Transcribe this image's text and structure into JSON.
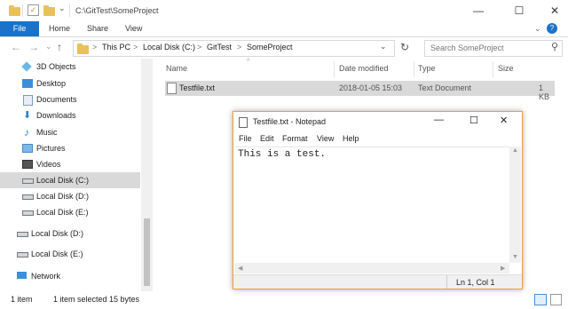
{
  "titlebar": {
    "path_title": "C:\\GitTest\\SomeProject",
    "minimize": "—",
    "maximize": "☐",
    "close": "✕"
  },
  "ribbon": {
    "tabs": [
      "File",
      "Home",
      "Share",
      "View"
    ],
    "expand": "⌄",
    "help": "?"
  },
  "address": {
    "back": "←",
    "forward": "→",
    "history": "⌄",
    "up": "↑",
    "crumbs": [
      "This PC",
      "Local Disk (C:)",
      "GitTest",
      "SomeProject"
    ],
    "sep": ">",
    "dropdown": "⌄",
    "refresh": "↻",
    "search_placeholder": "Search SomeProject"
  },
  "nav": {
    "items": [
      {
        "label": "3D Objects",
        "icon": "cube-icon"
      },
      {
        "label": "Desktop",
        "icon": "desktop-icon"
      },
      {
        "label": "Documents",
        "icon": "documents-icon"
      },
      {
        "label": "Downloads",
        "icon": "downloads-icon"
      },
      {
        "label": "Music",
        "icon": "music-icon"
      },
      {
        "label": "Pictures",
        "icon": "pictures-icon"
      },
      {
        "label": "Videos",
        "icon": "videos-icon"
      },
      {
        "label": "Local Disk (C:)",
        "icon": "drive-icon",
        "selected": true
      },
      {
        "label": "Local Disk (D:)",
        "icon": "drive-icon"
      },
      {
        "label": "Local Disk (E:)",
        "icon": "drive-icon"
      },
      {
        "label": "Local Disk (D:)",
        "icon": "drive-icon"
      },
      {
        "label": "Local Disk (E:)",
        "icon": "drive-icon"
      },
      {
        "label": "Network",
        "icon": "network-icon"
      }
    ]
  },
  "filelist": {
    "columns": [
      "Name",
      "Date modified",
      "Type",
      "Size"
    ],
    "rows": [
      {
        "name": "Testfile.txt",
        "date": "2018-01-05 15:03",
        "type": "Text Document",
        "size": "1 KB"
      }
    ]
  },
  "status": {
    "count": "1 item",
    "selected": "1 item selected  15 bytes"
  },
  "notepad": {
    "title": "Testfile.txt - Notepad",
    "menu": [
      "File",
      "Edit",
      "Format",
      "View",
      "Help"
    ],
    "content": "This is a test.",
    "position": "Ln 1, Col 1"
  },
  "colors": {
    "accent": "#1a73c8",
    "selection": "#d9d9d9",
    "notepad_border": "#e8a03c",
    "folder": "#e8c15a"
  }
}
